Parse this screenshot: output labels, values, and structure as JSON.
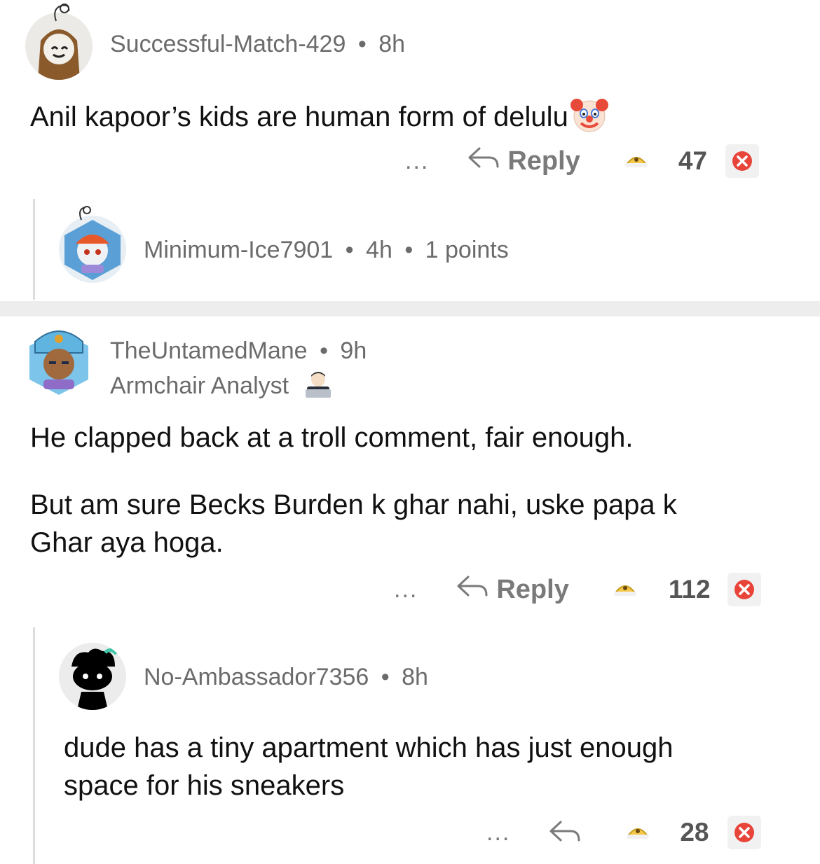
{
  "comments": [
    {
      "username": "Successful-Match-429",
      "sep": "•",
      "age": "8h",
      "text": "Anil kapoor’s kids are human form of delulu",
      "emoji_icon": "clown-face-icon",
      "actions": {
        "more": "...",
        "reply": "Reply",
        "score": "47"
      }
    },
    {
      "username": "Minimum-Ice7901",
      "sep": "•",
      "age": "4h",
      "sep2": "•",
      "points": "1 points"
    },
    {
      "username": "TheUntamedMane",
      "sep": "•",
      "age": "9h",
      "flair": "Armchair Analyst",
      "flair_icon": "technologist-emoji-icon",
      "paragraph1": "He clapped back at a troll comment, fair enough.",
      "paragraph2_line1": "But am sure Becks Burden k ghar nahi, uske papa k",
      "paragraph2_line2": "Ghar aya hoga.",
      "actions": {
        "more": "...",
        "reply": "Reply",
        "score": "112"
      }
    },
    {
      "username": "No-Ambassador7356",
      "sep": "•",
      "age": "8h",
      "line1": "dude has a tiny apartment which has just enough",
      "line2": "space for his sneakers",
      "actions": {
        "more": "...",
        "score": "28"
      }
    }
  ],
  "colors": {
    "accent_upvote": "#f5c84a",
    "downvote": "#e8443a",
    "meta": "#6b6b6b",
    "divider": "#ededed"
  }
}
